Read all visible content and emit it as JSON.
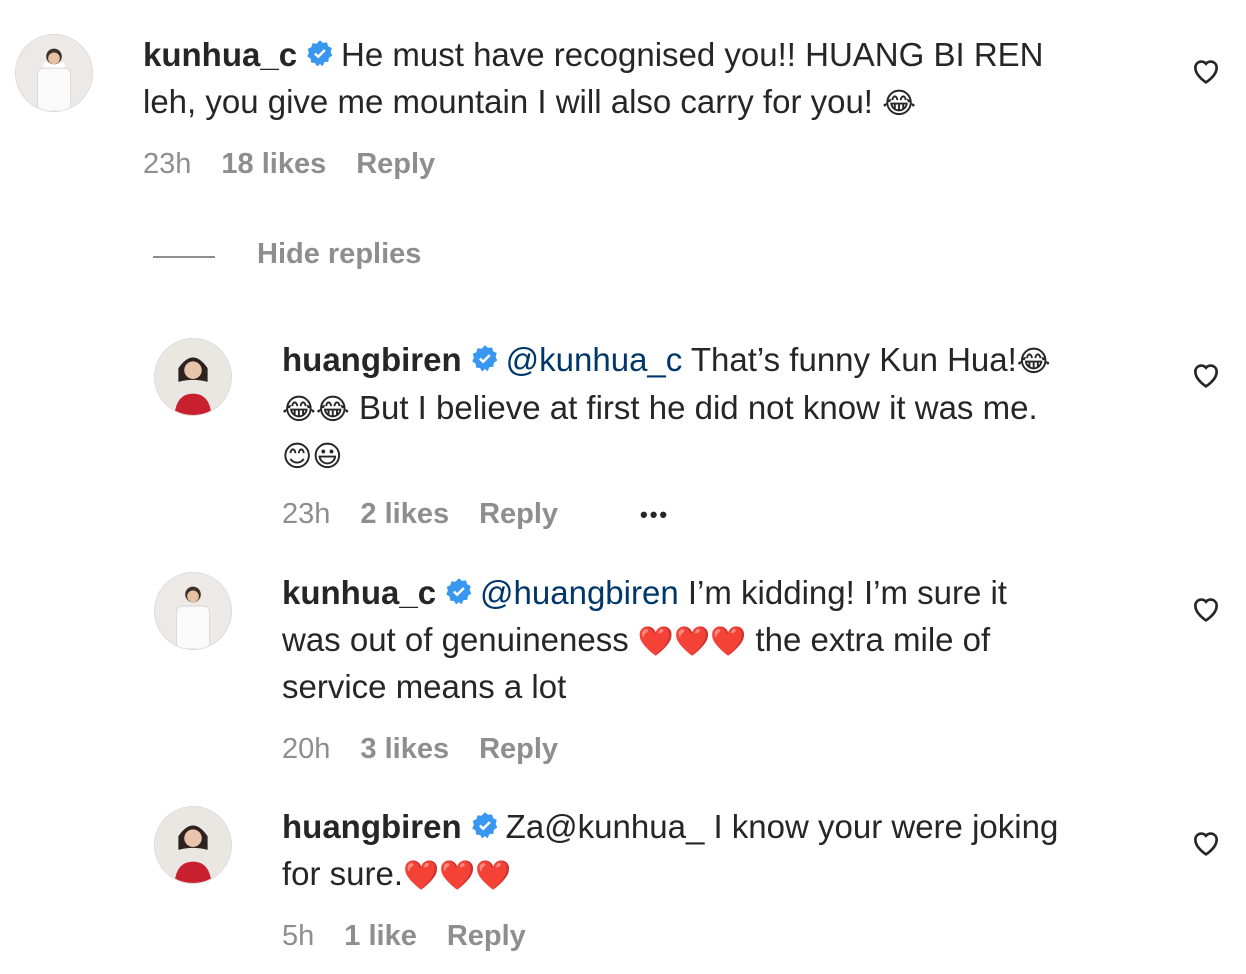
{
  "comments": [
    {
      "username": "kunhua_c",
      "mention": "",
      "text": "He must have recognised you!! HUANG BI REN\nleh, you give me mountain I will also carry for you! ",
      "emoji_tail": "😂",
      "time": "23h",
      "likes": "18 likes",
      "reply": "Reply"
    },
    {
      "username": "huangbiren",
      "mention": "@kunhua_c",
      "text": " That’s funny Kun Hua!",
      "line2_emoji": "😂😂",
      "line2_text": " But I believe at first he did not know it was me.",
      "line3_emoji": "😊😃",
      "first_emoji": "😂",
      "time": "23h",
      "likes": "2 likes",
      "reply": "Reply",
      "more": "•••"
    },
    {
      "username": "kunhua_c",
      "mention": "@huangbiren",
      "text": " I’m kidding! I’m sure it\nwas out of genuineness ",
      "hearts": "❤️❤️❤️",
      "text_after": " the extra mile of\nservice means a lot",
      "time": "20h",
      "likes": "3 likes",
      "reply": "Reply"
    },
    {
      "username": "huangbiren",
      "mention": "",
      "text": "Za@kunhua_ I know your were joking\nfor sure.",
      "hearts": "❤️❤️❤️",
      "time": "5h",
      "likes": "1 like",
      "reply": "Reply"
    }
  ],
  "hide_replies": "Hide replies",
  "colors": {
    "verified": "#3897f0",
    "mention": "#00376b",
    "meta": "#8e8e8e"
  }
}
